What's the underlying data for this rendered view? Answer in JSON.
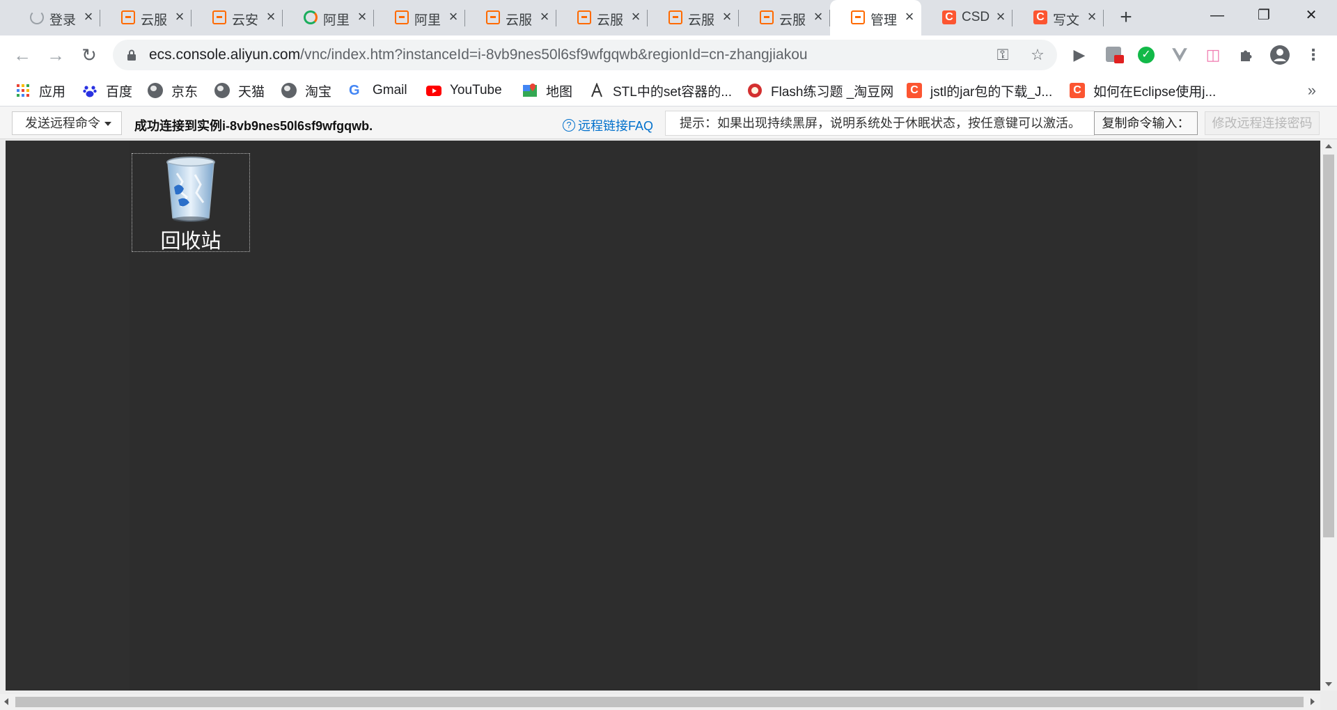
{
  "tabs": [
    {
      "title": "登录",
      "icon": "loading-spinner-icon"
    },
    {
      "title": "云服",
      "icon": "aliyun-icon"
    },
    {
      "title": "云安",
      "icon": "aliyun-icon"
    },
    {
      "title": "阿里",
      "icon": "aliyun-ring-icon"
    },
    {
      "title": "阿里",
      "icon": "aliyun-icon"
    },
    {
      "title": "云服",
      "icon": "aliyun-icon"
    },
    {
      "title": "云服",
      "icon": "aliyun-icon"
    },
    {
      "title": "云服",
      "icon": "aliyun-icon"
    },
    {
      "title": "云服",
      "icon": "aliyun-icon"
    },
    {
      "title": "管理",
      "icon": "aliyun-icon",
      "active": true
    },
    {
      "title": "CSD",
      "icon": "csdn-icon"
    },
    {
      "title": "写文",
      "icon": "csdn-icon"
    }
  ],
  "address_bar": {
    "host": "ecs.console.aliyun.com",
    "path": "/vnc/index.htm?instanceId=i-8vb9nes50l6sf9wfgqwb&regionId=cn-zhangjiakou"
  },
  "bookmarks": [
    {
      "label": "应用",
      "icon": "apps-grid-icon"
    },
    {
      "label": "百度",
      "icon": "baidu-paw-icon"
    },
    {
      "label": "京东",
      "icon": "globe-icon"
    },
    {
      "label": "天猫",
      "icon": "globe-icon"
    },
    {
      "label": "淘宝",
      "icon": "globe-icon"
    },
    {
      "label": "Gmail",
      "icon": "google-icon"
    },
    {
      "label": "YouTube",
      "icon": "youtube-icon"
    },
    {
      "label": "地图",
      "icon": "maps-icon"
    },
    {
      "label": "STL中的set容器的...",
      "icon": "stl-icon"
    },
    {
      "label": "Flash练习题 _淘豆网",
      "icon": "taodou-icon"
    },
    {
      "label": "jstl的jar包的下载_J...",
      "icon": "csdn-icon"
    },
    {
      "label": "如何在Eclipse使用j...",
      "icon": "csdn-icon"
    }
  ],
  "vnc": {
    "send_command_label": "发送远程命令",
    "status_message": "成功连接到实例i-8vb9nes50l6sf9wfgqwb.",
    "faq_label": "远程链接FAQ",
    "hint_text": "提示：如果出现持续黑屏，说明系统处于休眠状态，按任意键可以激活。",
    "copy_command_label": "复制命令输入：",
    "change_password_label": "修改远程连接密码"
  },
  "desktop": {
    "recycle_bin_label": "回收站"
  },
  "colors": {
    "aliyun_orange": "#ff6a00",
    "csdn_red": "#fc5531",
    "link_blue": "#0070cc",
    "desktop_bg": "#2d2d2d"
  }
}
